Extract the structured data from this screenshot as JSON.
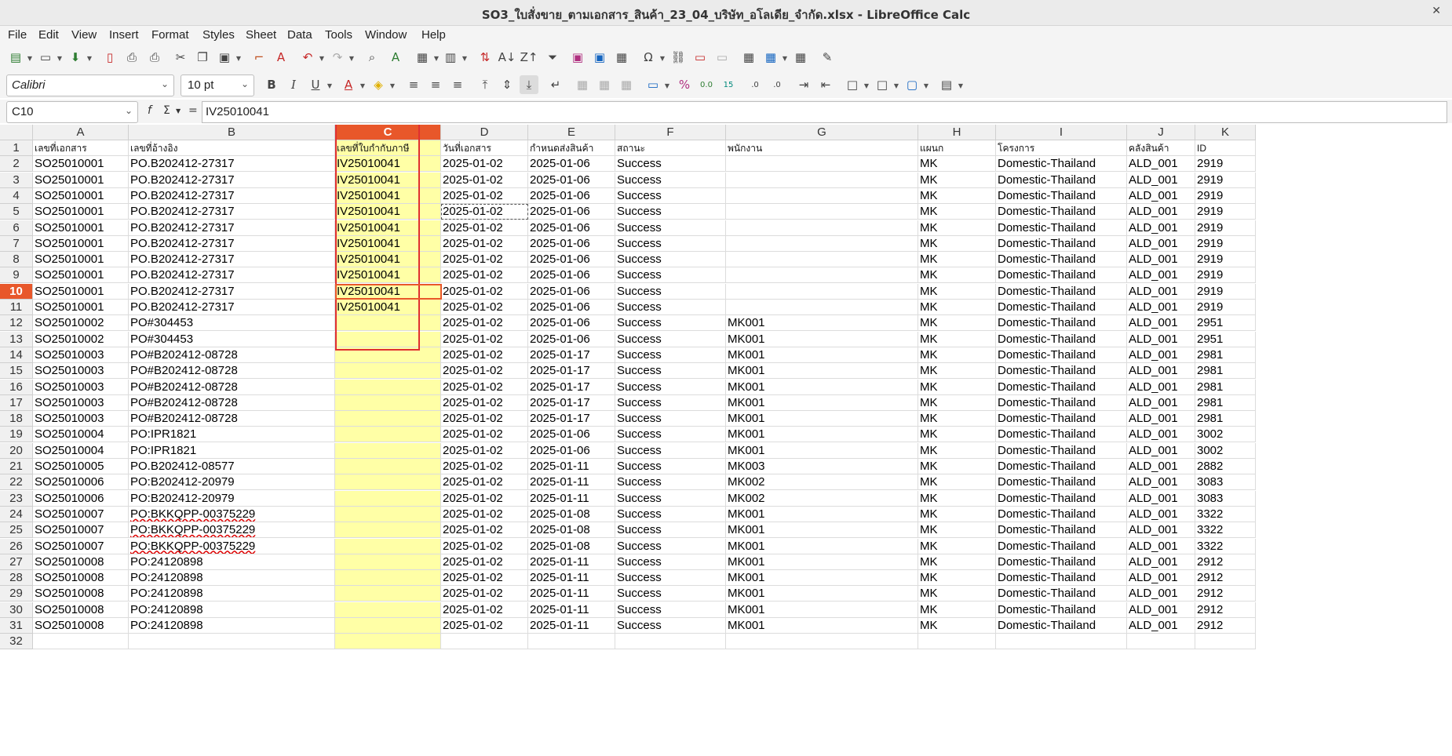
{
  "window": {
    "title": "SO3_ใบสั่งขาย_ตามเอกสาร_สินค้า_23_04_บริษัท_อโลเดีย_จำกัด.xlsx - LibreOffice Calc"
  },
  "menu": [
    "File",
    "Edit",
    "View",
    "Insert",
    "Format",
    "Styles",
    "Sheet",
    "Data",
    "Tools",
    "Window",
    "Help"
  ],
  "format_bar": {
    "font_name": "Calibri",
    "font_size": "10 pt"
  },
  "formula_bar": {
    "cell_ref": "C10",
    "fx_label": "f",
    "sum_label": "Σ",
    "equals_label": "=",
    "content": "IV25010041"
  },
  "sheet": {
    "columns": [
      "A",
      "B",
      "C",
      "D",
      "E",
      "F",
      "G",
      "H",
      "I",
      "J",
      "K"
    ],
    "selected_column": "C",
    "selected_row": 10,
    "header_row": [
      "เลขที่เอกสาร",
      "เลขที่อ้างอิง",
      "เลขที่ใบกำกับภาษี",
      "วันที่เอกสาร",
      "กำหนดส่งสินค้า",
      "สถานะ",
      "พนักงาน",
      "แผนก",
      "โครงการ",
      "คลังสินค้า",
      "ID"
    ],
    "rows": [
      [
        "SO25010001",
        "PO.B202412-27317",
        "IV25010041",
        "2025-01-02",
        "2025-01-06",
        "Success",
        "",
        "MK",
        "Domestic-Thailand",
        "ALD_001",
        "2919"
      ],
      [
        "SO25010001",
        "PO.B202412-27317",
        "IV25010041",
        "2025-01-02",
        "2025-01-06",
        "Success",
        "",
        "MK",
        "Domestic-Thailand",
        "ALD_001",
        "2919"
      ],
      [
        "SO25010001",
        "PO.B202412-27317",
        "IV25010041",
        "2025-01-02",
        "2025-01-06",
        "Success",
        "",
        "MK",
        "Domestic-Thailand",
        "ALD_001",
        "2919"
      ],
      [
        "SO25010001",
        "PO.B202412-27317",
        "IV25010041",
        "2025-01-02",
        "2025-01-06",
        "Success",
        "",
        "MK",
        "Domestic-Thailand",
        "ALD_001",
        "2919"
      ],
      [
        "SO25010001",
        "PO.B202412-27317",
        "IV25010041",
        "2025-01-02",
        "2025-01-06",
        "Success",
        "",
        "MK",
        "Domestic-Thailand",
        "ALD_001",
        "2919"
      ],
      [
        "SO25010001",
        "PO.B202412-27317",
        "IV25010041",
        "2025-01-02",
        "2025-01-06",
        "Success",
        "",
        "MK",
        "Domestic-Thailand",
        "ALD_001",
        "2919"
      ],
      [
        "SO25010001",
        "PO.B202412-27317",
        "IV25010041",
        "2025-01-02",
        "2025-01-06",
        "Success",
        "",
        "MK",
        "Domestic-Thailand",
        "ALD_001",
        "2919"
      ],
      [
        "SO25010001",
        "PO.B202412-27317",
        "IV25010041",
        "2025-01-02",
        "2025-01-06",
        "Success",
        "",
        "MK",
        "Domestic-Thailand",
        "ALD_001",
        "2919"
      ],
      [
        "SO25010001",
        "PO.B202412-27317",
        "IV25010041",
        "2025-01-02",
        "2025-01-06",
        "Success",
        "",
        "MK",
        "Domestic-Thailand",
        "ALD_001",
        "2919"
      ],
      [
        "SO25010001",
        "PO.B202412-27317",
        "IV25010041",
        "2025-01-02",
        "2025-01-06",
        "Success",
        "",
        "MK",
        "Domestic-Thailand",
        "ALD_001",
        "2919"
      ],
      [
        "SO25010002",
        "PO#304453",
        "",
        "2025-01-02",
        "2025-01-06",
        "Success",
        "MK001",
        "MK",
        "Domestic-Thailand",
        "ALD_001",
        "2951"
      ],
      [
        "SO25010002",
        "PO#304453",
        "",
        "2025-01-02",
        "2025-01-06",
        "Success",
        "MK001",
        "MK",
        "Domestic-Thailand",
        "ALD_001",
        "2951"
      ],
      [
        "SO25010003",
        "PO#B202412-08728",
        "",
        "2025-01-02",
        "2025-01-17",
        "Success",
        "MK001",
        "MK",
        "Domestic-Thailand",
        "ALD_001",
        "2981"
      ],
      [
        "SO25010003",
        "PO#B202412-08728",
        "",
        "2025-01-02",
        "2025-01-17",
        "Success",
        "MK001",
        "MK",
        "Domestic-Thailand",
        "ALD_001",
        "2981"
      ],
      [
        "SO25010003",
        "PO#B202412-08728",
        "",
        "2025-01-02",
        "2025-01-17",
        "Success",
        "MK001",
        "MK",
        "Domestic-Thailand",
        "ALD_001",
        "2981"
      ],
      [
        "SO25010003",
        "PO#B202412-08728",
        "",
        "2025-01-02",
        "2025-01-17",
        "Success",
        "MK001",
        "MK",
        "Domestic-Thailand",
        "ALD_001",
        "2981"
      ],
      [
        "SO25010003",
        "PO#B202412-08728",
        "",
        "2025-01-02",
        "2025-01-17",
        "Success",
        "MK001",
        "MK",
        "Domestic-Thailand",
        "ALD_001",
        "2981"
      ],
      [
        "SO25010004",
        "PO:IPR1821",
        "",
        "2025-01-02",
        "2025-01-06",
        "Success",
        "MK001",
        "MK",
        "Domestic-Thailand",
        "ALD_001",
        "3002"
      ],
      [
        "SO25010004",
        "PO:IPR1821",
        "",
        "2025-01-02",
        "2025-01-06",
        "Success",
        "MK001",
        "MK",
        "Domestic-Thailand",
        "ALD_001",
        "3002"
      ],
      [
        "SO25010005",
        "PO.B202412-08577",
        "",
        "2025-01-02",
        "2025-01-11",
        "Success",
        "MK003",
        "MK",
        "Domestic-Thailand",
        "ALD_001",
        "2882"
      ],
      [
        "SO25010006",
        "PO:B202412-20979",
        "",
        "2025-01-02",
        "2025-01-11",
        "Success",
        "MK002",
        "MK",
        "Domestic-Thailand",
        "ALD_001",
        "3083"
      ],
      [
        "SO25010006",
        "PO:B202412-20979",
        "",
        "2025-01-02",
        "2025-01-11",
        "Success",
        "MK002",
        "MK",
        "Domestic-Thailand",
        "ALD_001",
        "3083"
      ],
      [
        "SO25010007",
        "PO:BKKQPP-00375229",
        "",
        "2025-01-02",
        "2025-01-08",
        "Success",
        "MK001",
        "MK",
        "Domestic-Thailand",
        "ALD_001",
        "3322"
      ],
      [
        "SO25010007",
        "PO:BKKQPP-00375229",
        "",
        "2025-01-02",
        "2025-01-08",
        "Success",
        "MK001",
        "MK",
        "Domestic-Thailand",
        "ALD_001",
        "3322"
      ],
      [
        "SO25010007",
        "PO:BKKQPP-00375229",
        "",
        "2025-01-02",
        "2025-01-08",
        "Success",
        "MK001",
        "MK",
        "Domestic-Thailand",
        "ALD_001",
        "3322"
      ],
      [
        "SO25010008",
        "PO:24120898",
        "",
        "2025-01-02",
        "2025-01-11",
        "Success",
        "MK001",
        "MK",
        "Domestic-Thailand",
        "ALD_001",
        "2912"
      ],
      [
        "SO25010008",
        "PO:24120898",
        "",
        "2025-01-02",
        "2025-01-11",
        "Success",
        "MK001",
        "MK",
        "Domestic-Thailand",
        "ALD_001",
        "2912"
      ],
      [
        "SO25010008",
        "PO:24120898",
        "",
        "2025-01-02",
        "2025-01-11",
        "Success",
        "MK001",
        "MK",
        "Domestic-Thailand",
        "ALD_001",
        "2912"
      ],
      [
        "SO25010008",
        "PO:24120898",
        "",
        "2025-01-02",
        "2025-01-11",
        "Success",
        "MK001",
        "MK",
        "Domestic-Thailand",
        "ALD_001",
        "2912"
      ],
      [
        "SO25010008",
        "PO:24120898",
        "",
        "2025-01-02",
        "2025-01-11",
        "Success",
        "MK001",
        "MK",
        "Domestic-Thailand",
        "ALD_001",
        "2912"
      ]
    ]
  },
  "colors": {
    "selection_header": "#e8572a",
    "column_highlight": "#ffffa6",
    "annotation_box": "#e03030"
  }
}
